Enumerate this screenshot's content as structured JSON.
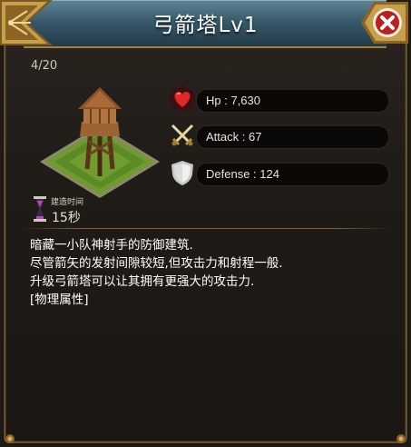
{
  "dialog": {
    "title": "弓箭塔Lv1",
    "counter": "4/20",
    "close_icon": "close-icon",
    "building_image": "archer-tower-image"
  },
  "stats": [
    {
      "icon": "heart-icon",
      "text": "Hp : 7,630"
    },
    {
      "icon": "crossed-swords-icon",
      "text": "Attack : 67"
    },
    {
      "icon": "shield-icon",
      "text": "Defense : 124"
    }
  ],
  "build": {
    "icon": "hourglass-icon",
    "label": "建造时间",
    "time": "15秒"
  },
  "description": [
    "暗藏一小队神射手的防御建筑.",
    "尽管箭矢的发射间隙较短,但攻击力和射程一般.",
    "升级弓箭塔可以让其拥有更强大的攻击力.",
    "[物理属性]"
  ],
  "colors": {
    "title_bar": "#38596a",
    "gold_trim": "#a8822e",
    "close_button": "#b8211c",
    "background": "#1e1a16"
  }
}
